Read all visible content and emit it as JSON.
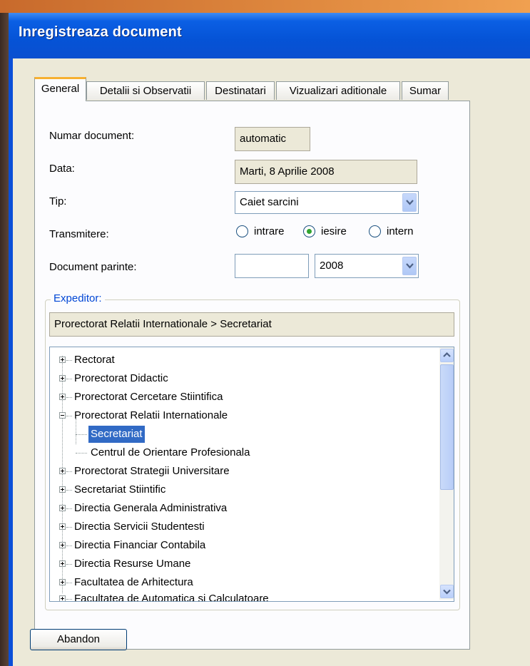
{
  "window": {
    "title": "Inregistreaza document"
  },
  "tabs": [
    "General",
    "Detalii si Observatii",
    "Destinatari",
    "Vizualizari aditionale",
    "Sumar"
  ],
  "form": {
    "numar_label": "Numar document:",
    "numar_value": "automatic",
    "data_label": "Data:",
    "data_value": "Marti, 8 Aprilie 2008",
    "tip_label": "Tip:",
    "tip_value": "Caiet sarcini",
    "transmitere_label": "Transmitere:",
    "radio_intrare": "intrare",
    "radio_iesire": "iesire",
    "radio_intern": "intern",
    "selected_radio": "iesire",
    "parinte_label": "Document parinte:",
    "parinte_value": "",
    "year_value": "2008"
  },
  "expeditor": {
    "legend": "Expeditor:",
    "path": "Prorectorat Relatii Internationale > Secretariat"
  },
  "tree": [
    "Rectorat",
    "Prorectorat Didactic",
    "Prorectorat Cercetare Stiintifica",
    "Prorectorat Relatii Internationale",
    "Secretariat",
    "Centrul de Orientare Profesionala",
    "Prorectorat Strategii Universitare",
    "Secretariat Stiintific",
    "Directia Generala Administrativa",
    "Directia Servicii Studentesti",
    "Directia Financiar Contabila",
    "Directia Resurse Umane",
    "Facultatea de Arhitectura",
    "Facultatea de Automatica si Calculatoare"
  ],
  "buttons": {
    "abandon": "Abandon"
  }
}
